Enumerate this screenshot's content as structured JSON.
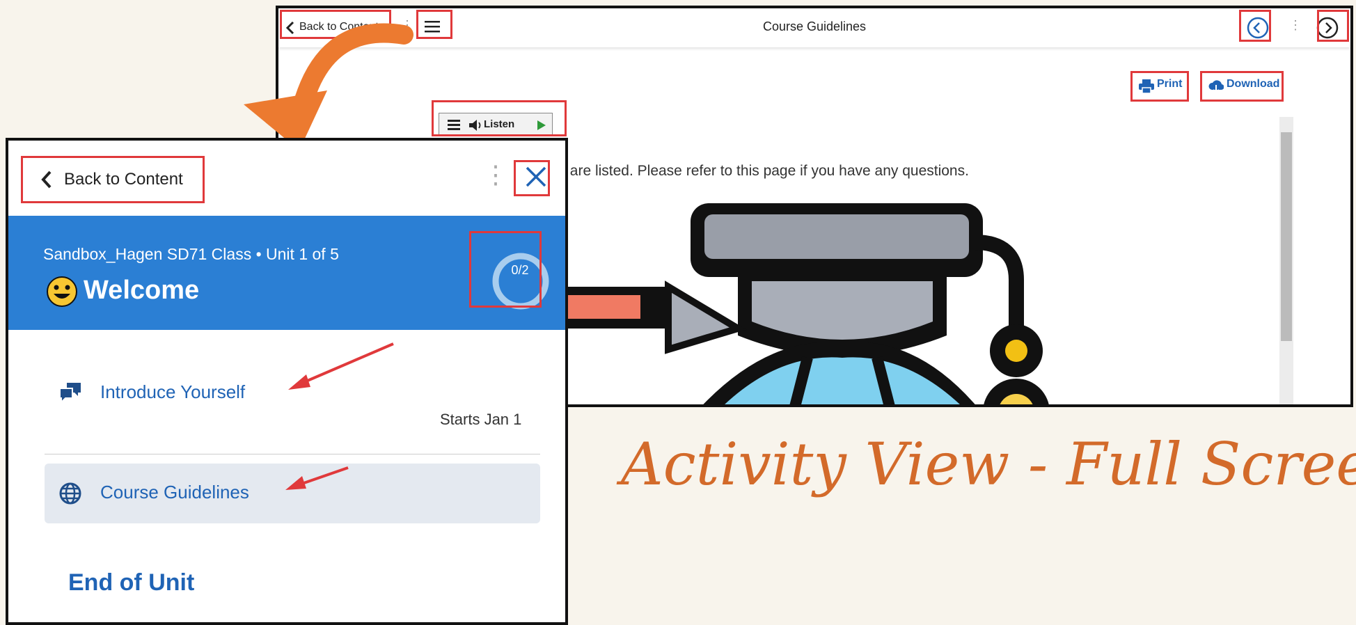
{
  "full_view": {
    "back_label": "Back to Content",
    "title": "Course Guidelines",
    "print_label": "Print",
    "download_label": "Download",
    "listen_label": "Listen",
    "intro_text": "ourse guidelines are listed.  Please refer to this page if you have any questions."
  },
  "panel": {
    "back_label": "Back to Content",
    "course_line": "Sandbox_Hagen SD71 Class  •  Unit 1 of 5",
    "unit_title": "Welcome",
    "progress": "0/2",
    "activities": [
      {
        "label": "Introduce Yourself",
        "icon": "discussion-icon",
        "note": "Starts Jan 1"
      },
      {
        "label": "Course Guidelines",
        "icon": "globe-icon"
      }
    ],
    "end_label": "End of Unit"
  },
  "caption": "Activity View - Full Screen",
  "colors": {
    "accent": "#2b7fd4",
    "link": "#1f63b5",
    "highlight_box": "#e0393b",
    "caption": "#d36a2a",
    "arrow": "#ec7a30"
  }
}
